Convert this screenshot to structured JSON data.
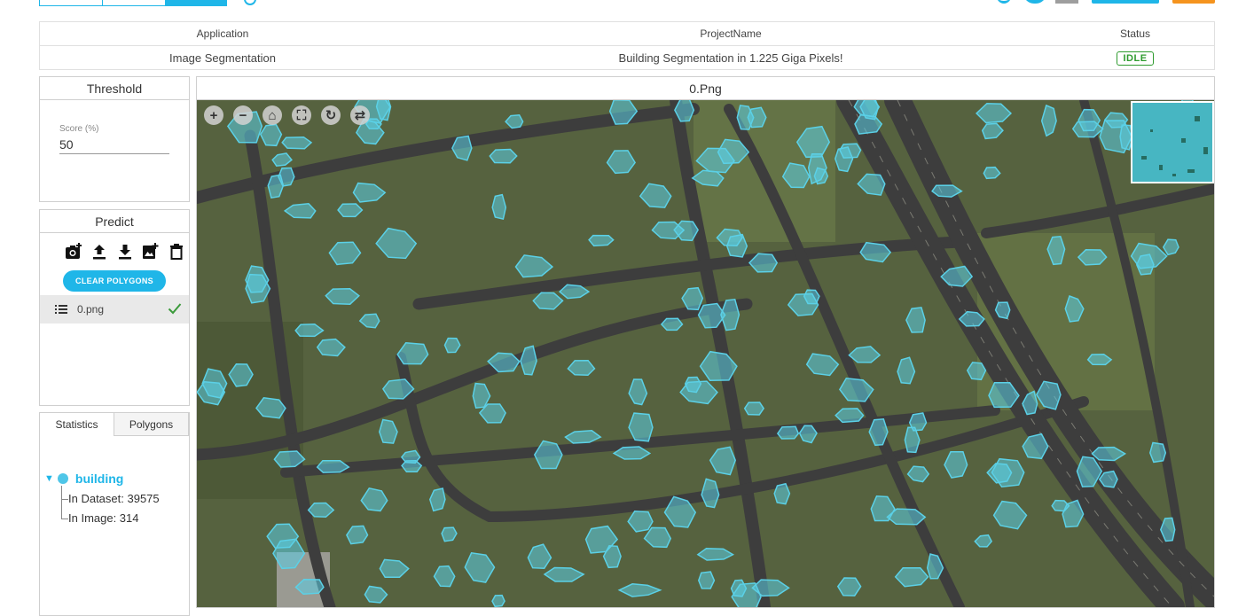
{
  "info_table": {
    "headers": {
      "application": "Application",
      "project": "ProjectName",
      "status": "Status"
    },
    "values": {
      "application": "Image Segmentation",
      "project": "Building Segmentation in 1.225 Giga Pixels!",
      "status": "IDLE"
    }
  },
  "threshold": {
    "title": "Threshold",
    "score_label": "Score (%)",
    "score_value": "50"
  },
  "predict": {
    "title": "Predict",
    "icons": [
      "camera-plus-icon",
      "upload-icon",
      "download-icon",
      "add-image-icon",
      "trash-icon"
    ],
    "clear_button": "CLEAR POLYGONS",
    "file": {
      "name": "0.png"
    }
  },
  "stats": {
    "tabs": [
      "Statistics",
      "Polygons"
    ],
    "active_tab": "Statistics",
    "class_name": "building",
    "in_dataset": "In Dataset: 39575",
    "in_image": "In Image: 314"
  },
  "viewer": {
    "title": "0.Png",
    "zoom_controls": [
      "zoom-in-icon",
      "zoom-out-icon",
      "home-icon",
      "fullscreen-icon",
      "rotate-icon",
      "flip-icon"
    ]
  },
  "colors": {
    "accent": "#1fb6e8",
    "status_idle": "#2e9b2e",
    "polygon": "#5bd0e6",
    "orange": "#f5941e"
  }
}
